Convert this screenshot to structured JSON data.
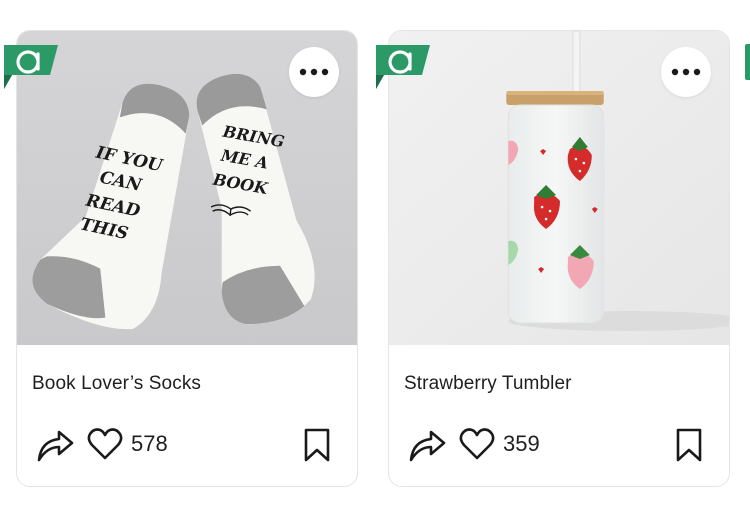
{
  "brand": {
    "accent": "#2c9a66",
    "badge_icon": "a-logo-icon"
  },
  "cards": [
    {
      "title": "Book Lover’s Socks",
      "likes": "578",
      "sock_left_text": [
        "IF YOU",
        "CAN",
        "READ",
        "THIS"
      ],
      "sock_right_text": [
        "BRING",
        "ME A",
        "BOOK"
      ]
    },
    {
      "title": "Strawberry Tumbler",
      "likes": "359"
    }
  ]
}
